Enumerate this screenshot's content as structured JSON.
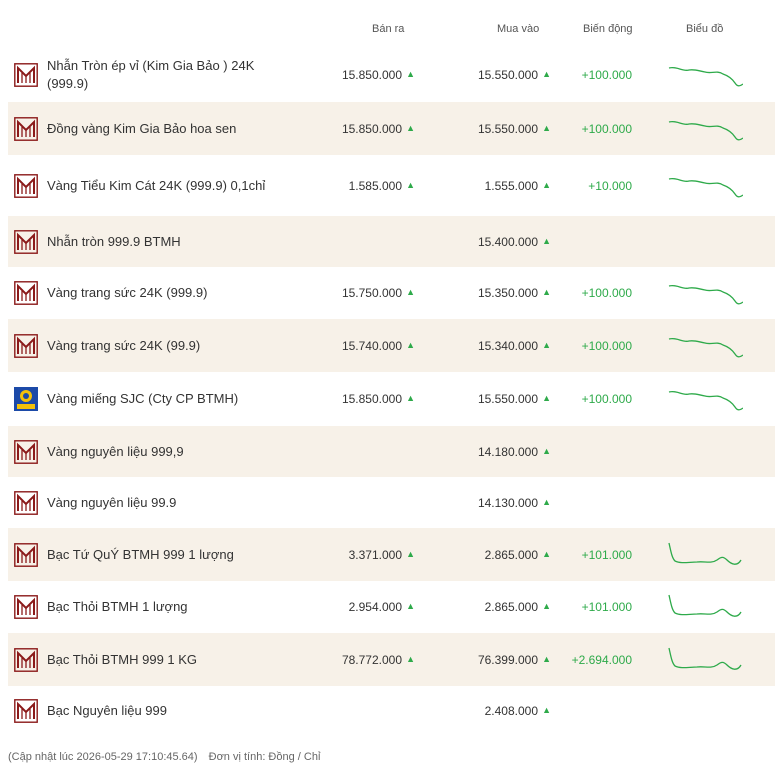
{
  "header": {
    "sell": "Bán ra",
    "buy": "Mua vào",
    "change": "Biến động",
    "chart": "Biểu đồ"
  },
  "colors": {
    "up": "#2eaa4a",
    "row_alt": "#f7f1e8",
    "brand": "#8b1a1a",
    "sjc_blue": "#1c4aa8",
    "sjc_yellow": "#f3c10a"
  },
  "rows": [
    {
      "name": "Nhẫn Tròn ép vỉ (Kim Gia Bảo ) 24K (999.9)",
      "sell": "15.850.000",
      "buy": "15.550.000",
      "change": "+100.000",
      "logo": "btmh-logo",
      "trend": "gold"
    },
    {
      "name": "Đồng vàng Kim Gia Bảo hoa sen",
      "sell": "15.850.000",
      "buy": "15.550.000",
      "change": "+100.000",
      "logo": "btmh-logo",
      "trend": "gold"
    },
    {
      "name": "Vàng Tiểu Kim Cát 24K (999.9) 0,1chỉ",
      "sell": "1.585.000",
      "buy": "1.555.000",
      "change": "+10.000",
      "logo": "btmh-logo",
      "trend": "gold"
    },
    {
      "name": "Nhẫn tròn 999.9 BTMH",
      "sell": "",
      "buy": "15.400.000",
      "change": "",
      "logo": "btmh-logo",
      "trend": ""
    },
    {
      "name": "Vàng trang sức 24K (999.9)",
      "sell": "15.750.000",
      "buy": "15.350.000",
      "change": "+100.000",
      "logo": "btmh-logo",
      "trend": "gold"
    },
    {
      "name": "Vàng trang sức 24K (99.9)",
      "sell": "15.740.000",
      "buy": "15.340.000",
      "change": "+100.000",
      "logo": "btmh-logo",
      "trend": "gold"
    },
    {
      "name": "Vàng miếng SJC (Cty CP BTMH)",
      "sell": "15.850.000",
      "buy": "15.550.000",
      "change": "+100.000",
      "logo": "sjc-logo",
      "trend": "gold"
    },
    {
      "name": "Vàng nguyên liệu 999,9",
      "sell": "",
      "buy": "14.180.000",
      "change": "",
      "logo": "btmh-logo",
      "trend": ""
    },
    {
      "name": "Vàng nguyên liệu 99.9",
      "sell": "",
      "buy": "14.130.000",
      "change": "",
      "logo": "btmh-logo",
      "trend": ""
    },
    {
      "name": "Bạc Tứ QuÝ BTMH 999 1 lượng",
      "sell": "3.371.000",
      "buy": "2.865.000",
      "change": "+101.000",
      "logo": "btmh-logo",
      "trend": "silver"
    },
    {
      "name": "Bạc Thỏi BTMH 1 lượng",
      "sell": "2.954.000",
      "buy": "2.865.000",
      "change": "+101.000",
      "logo": "btmh-logo",
      "trend": "silver"
    },
    {
      "name": "Bạc Thỏi BTMH 999 1 KG",
      "sell": "78.772.000",
      "buy": "76.399.000",
      "change": "+2.694.000",
      "logo": "btmh-logo",
      "trend": "silver"
    },
    {
      "name": "Bạc Nguyên liệu 999",
      "sell": "",
      "buy": "2.408.000",
      "change": "",
      "logo": "btmh-logo",
      "trend": ""
    }
  ],
  "footer": {
    "updated": "(Cập nhật lúc 2026-05-29 17:10:45.64)",
    "unit": "Đơn vị tính: Đồng / Chỉ"
  }
}
